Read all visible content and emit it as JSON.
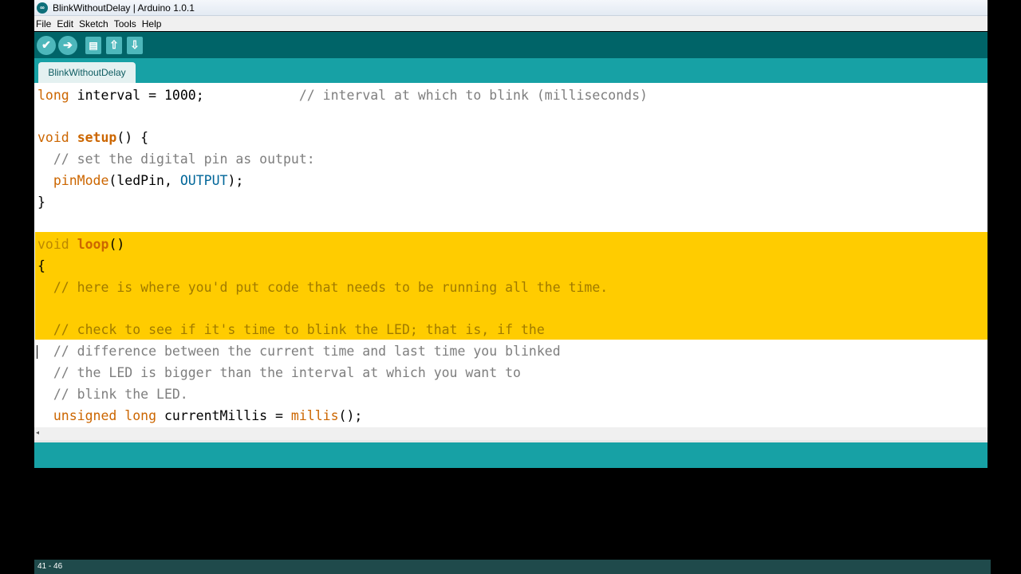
{
  "window": {
    "title": "BlinkWithoutDelay | Arduino 1.0.1"
  },
  "menu": [
    "File",
    "Edit",
    "Sketch",
    "Tools",
    "Help"
  ],
  "toolbar": {
    "verify_icon": "✔",
    "upload_icon": "➔",
    "new_icon": "▤",
    "open_icon": "⇧",
    "save_icon": "⇩"
  },
  "tabs": [
    {
      "label": "BlinkWithoutDelay"
    }
  ],
  "code": {
    "line1": {
      "type": "long",
      "rest": " interval = 1000;",
      "comment": "            // interval at which to blink (milliseconds)"
    },
    "line3": {
      "type": "void",
      "fn": "setup",
      "rest": "() {"
    },
    "line4": {
      "comment": "  // set the digital pin as output:"
    },
    "line5": {
      "indent": "  ",
      "fn": "pinMode",
      "a": "(ledPin, ",
      "const": "OUTPUT",
      "b": ");"
    },
    "line6": {
      "text": "}"
    },
    "line8": {
      "type": "void",
      "fn": "loop",
      "rest": "()"
    },
    "line9": {
      "text": "{"
    },
    "line10": {
      "comment": "  // here is where you'd put code that needs to be running all the time."
    },
    "line12": {
      "comment": "  // check to see if it's time to blink the LED; that is, if the"
    },
    "line13": {
      "comment": "  // difference between the current time and last time you blinked"
    },
    "line14": {
      "comment": "  // the LED is bigger than the interval at which you want to"
    },
    "line15": {
      "comment": "  // blink the LED."
    },
    "line16": {
      "indent": "  ",
      "type": "unsigned long",
      "rest": " currentMillis = ",
      "fn": "millis",
      "b": "();"
    }
  },
  "scroll_arrow": "◂",
  "status": {
    "line_range": "41 - 46"
  },
  "colors": {
    "toolbar": "#006468",
    "tabbar": "#17a1a5",
    "highlight": "#ffcc00",
    "keyword": "#cc6600",
    "constant": "#006699",
    "comment": "#7e7e7e"
  },
  "icons": {
    "cursor": "mouse-pointer-icon"
  }
}
